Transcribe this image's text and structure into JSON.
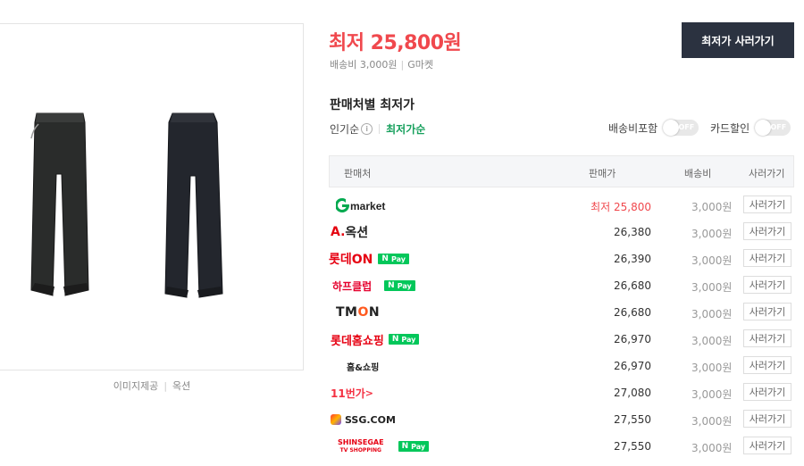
{
  "product": {
    "image_credit_label": "이미지제공",
    "image_credit_source": "옥션"
  },
  "summary": {
    "price_text": "최저 25,800원",
    "shipping_text": "배송비 3,000원",
    "shipping_seller": "G마켓",
    "buy_button_label": "최저가 사러가기"
  },
  "section": {
    "title": "판매처별 최저가",
    "sort_popular": "인기순",
    "sort_lowest": "최저가순",
    "toggle_shipping_label": "배송비포함",
    "toggle_card_label": "카드할인",
    "toggle_off_text": "OFF"
  },
  "table": {
    "headers": {
      "seller": "판매처",
      "price": "판매가",
      "shipping": "배송비",
      "buy": "사러가기"
    },
    "rows": [
      {
        "seller": "Gmarket",
        "price": "최저 25,800",
        "shipping": "3,000원",
        "buy": "사러가기",
        "npay": false
      },
      {
        "seller": "옥션",
        "price": "26,380",
        "shipping": "3,000원",
        "buy": "사러가기",
        "npay": false
      },
      {
        "seller": "롯데ON",
        "price": "26,390",
        "shipping": "3,000원",
        "buy": "사러가기",
        "npay": true
      },
      {
        "seller": "하프클럽",
        "price": "26,680",
        "shipping": "3,000원",
        "buy": "사러가기",
        "npay": true
      },
      {
        "seller": "TMON",
        "price": "26,680",
        "shipping": "3,000원",
        "buy": "사러가기",
        "npay": false
      },
      {
        "seller": "롯데홈쇼핑",
        "price": "26,970",
        "shipping": "3,000원",
        "buy": "사러가기",
        "npay": true
      },
      {
        "seller": "홈&쇼핑",
        "price": "26,970",
        "shipping": "3,000원",
        "buy": "사러가기",
        "npay": false
      },
      {
        "seller": "11번가",
        "price": "27,080",
        "shipping": "3,000원",
        "buy": "사러가기",
        "npay": false
      },
      {
        "seller": "SSG.COM",
        "price": "27,550",
        "shipping": "3,000원",
        "buy": "사러가기",
        "npay": false
      },
      {
        "seller": "SHINSEGAE",
        "seller_sub": "TV SHOPPING",
        "price": "27,550",
        "shipping": "3,000원",
        "buy": "사러가기",
        "npay": true
      }
    ],
    "npay_label": "Pay",
    "npay_letter": "N"
  },
  "colors": {
    "price_red": "#f0484d",
    "button_dark": "#2b3240",
    "active_green": "#17a05d",
    "npay_green": "#03c75a"
  }
}
